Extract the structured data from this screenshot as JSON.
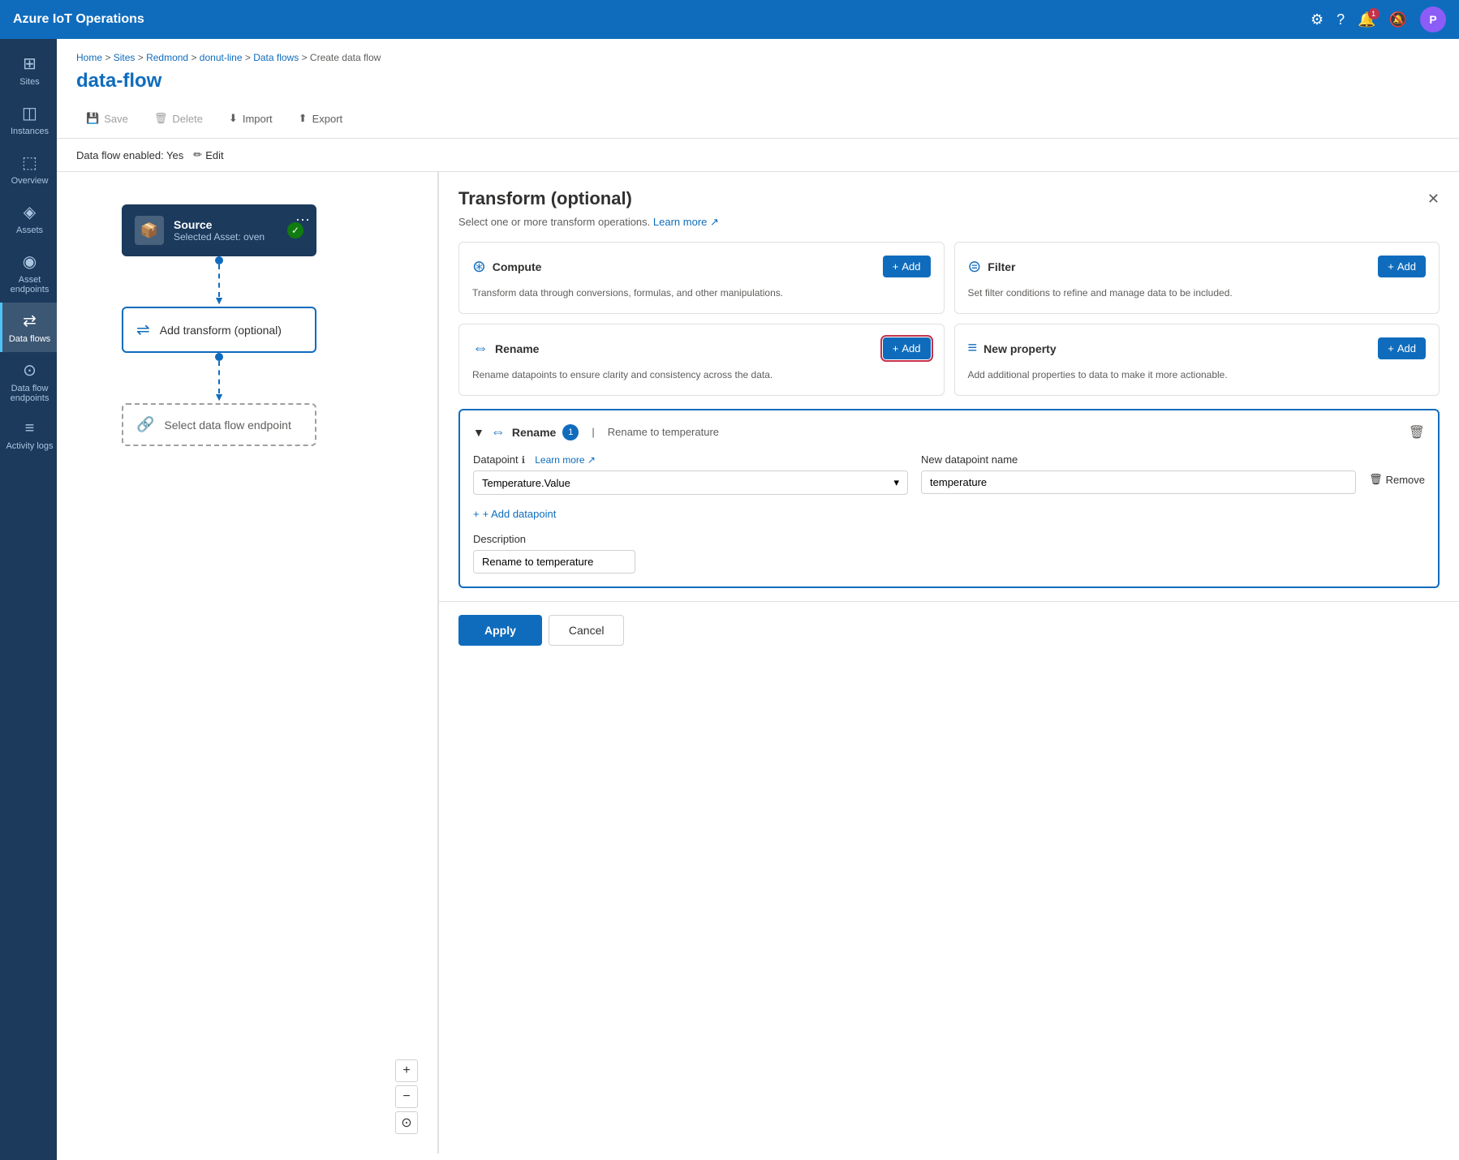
{
  "app": {
    "title": "Azure IoT Operations"
  },
  "topnav": {
    "title": "Azure IoT Operations",
    "notification_count": "1",
    "avatar_letter": "P"
  },
  "sidebar": {
    "items": [
      {
        "id": "sites",
        "label": "Sites",
        "icon": "⊞"
      },
      {
        "id": "instances",
        "label": "Instances",
        "icon": "◫"
      },
      {
        "id": "overview",
        "label": "Overview",
        "icon": "⬚"
      },
      {
        "id": "assets",
        "label": "Assets",
        "icon": "◈"
      },
      {
        "id": "asset-endpoints",
        "label": "Asset endpoints",
        "icon": "◉"
      },
      {
        "id": "data-flows",
        "label": "Data flows",
        "icon": "⇄"
      },
      {
        "id": "data-flow-endpoints",
        "label": "Data flow endpoints",
        "icon": "⊙"
      },
      {
        "id": "activity-logs",
        "label": "Activity logs",
        "icon": "≡"
      }
    ]
  },
  "breadcrumb": {
    "items": [
      "Home",
      "Sites",
      "Redmond",
      "donut-line",
      "Data flows",
      "Create data flow"
    ]
  },
  "page": {
    "title": "data-flow"
  },
  "toolbar": {
    "save_label": "Save",
    "delete_label": "Delete",
    "import_label": "Import",
    "export_label": "Export"
  },
  "enabled_bar": {
    "text": "Data flow enabled: Yes",
    "edit_label": "Edit"
  },
  "canvas": {
    "source_node": {
      "title": "Source",
      "subtitle": "Selected Asset: oven"
    },
    "transform_node": {
      "label": "Add transform (optional)"
    },
    "endpoint_node": {
      "label": "Select data flow endpoint"
    }
  },
  "transform_panel": {
    "title": "Transform (optional)",
    "subtitle": "Select one or more transform operations.",
    "learn_more_label": "Learn more",
    "cards": [
      {
        "id": "compute",
        "icon": "⊛",
        "title": "Compute",
        "add_label": "+ Add",
        "description": "Transform data through conversions, formulas, and other manipulations."
      },
      {
        "id": "filter",
        "icon": "⊜",
        "title": "Filter",
        "add_label": "+ Add",
        "description": "Set filter conditions to refine and manage data to be included."
      },
      {
        "id": "rename",
        "icon": "⇔",
        "title": "Rename",
        "add_label": "+ Add",
        "description": "Rename datapoints to ensure clarity and consistency across the data.",
        "highlighted": true
      },
      {
        "id": "new-property",
        "icon": "≡",
        "title": "New property",
        "add_label": "+ Add",
        "description": "Add additional properties to data to make it more actionable."
      }
    ],
    "rename_section": {
      "label": "Rename",
      "badge": "1",
      "description": "Rename to temperature",
      "datapoint_label": "Datapoint",
      "learn_more_label": "Learn more",
      "datapoint_value": "Temperature.Value",
      "new_name_label": "New datapoint name",
      "new_name_value": "temperature",
      "remove_label": "Remove",
      "add_datapoint_label": "+ Add datapoint",
      "description_label": "Description",
      "description_value": "Rename to temperature"
    },
    "footer": {
      "apply_label": "Apply",
      "cancel_label": "Cancel"
    }
  }
}
